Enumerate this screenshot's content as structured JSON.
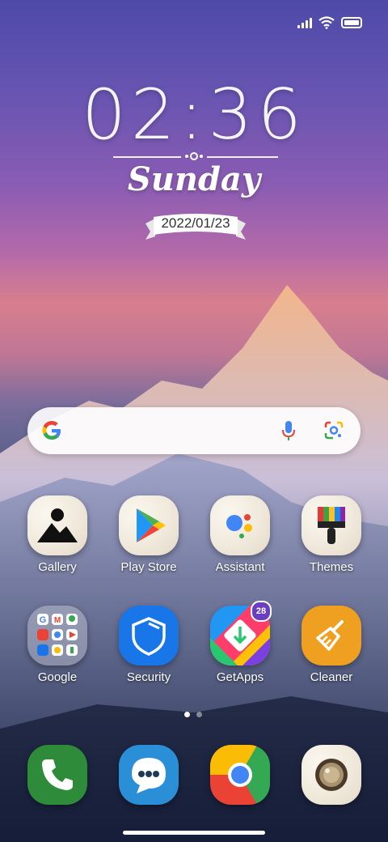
{
  "status_bar": {
    "icons": [
      "signal-icon",
      "wifi-icon",
      "battery-icon"
    ]
  },
  "clock": {
    "time": "02:36",
    "day": "Sunday",
    "date": "2022/01/23"
  },
  "search": {
    "icons": [
      "google-g-icon",
      "microphone-icon",
      "google-lens-icon"
    ]
  },
  "apps_row1": [
    {
      "label": "Gallery"
    },
    {
      "label": "Play Store"
    },
    {
      "label": "Assistant"
    },
    {
      "label": "Themes"
    }
  ],
  "apps_row2": [
    {
      "label": "Google"
    },
    {
      "label": "Security"
    },
    {
      "label": "GetApps",
      "badge": "28"
    },
    {
      "label": "Cleaner"
    }
  ],
  "dock": [
    {
      "name": "Phone"
    },
    {
      "name": "Messages"
    },
    {
      "name": "Chrome"
    },
    {
      "name": "Camera"
    }
  ],
  "page_indicator": {
    "pages": 2,
    "current": 1
  },
  "colors": {
    "badge": "#6a3fbf",
    "security": "#1976e8",
    "cleaner": "#f0a020",
    "phone": "#2e8b3a"
  }
}
